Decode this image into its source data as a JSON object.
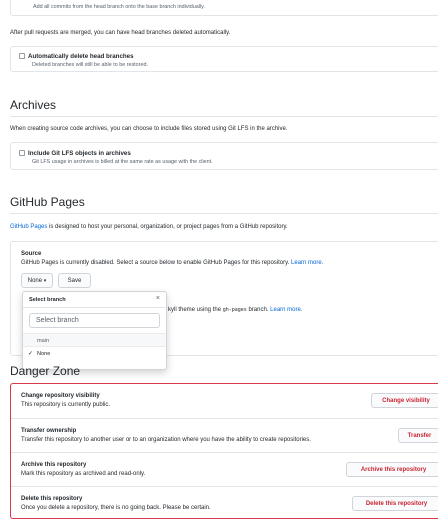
{
  "merge": {
    "rebase_desc": "Add all commits from the head branch onto the base branch individually.",
    "auto_delete_intro": "After pull requests are merged, you can have head branches deleted automatically.",
    "auto_delete_label": "Automatically delete head branches",
    "auto_delete_desc": "Deleted branches will still be able to be restored."
  },
  "archives": {
    "title": "Archives",
    "intro": "When creating source code archives, you can choose to include files stored using Git LFS in the archive.",
    "lfs_label": "Include Git LFS objects in archives",
    "lfs_desc": "Git LFS usage in archives is billed at the same rate as usage with the client."
  },
  "pages": {
    "title": "GitHub Pages",
    "intro_link": "GitHub Pages",
    "intro_rest": " is designed to host your personal, organization, or project pages from a GitHub repository.",
    "source_label": "Source",
    "source_desc": "GitHub Pages is currently disabled. Select a source below to enable GitHub Pages for this repository.",
    "learn_more": "Learn more.",
    "branch_button": "None",
    "save_button": "Save",
    "theme_text_a": "kyll theme using the ",
    "theme_code": "gh-pages",
    "theme_text_b": " branch.",
    "theme_learn_more": "Learn more."
  },
  "dropdown": {
    "title": "Select branch",
    "filter_placeholder": "Select branch",
    "items": [
      "main",
      "None"
    ]
  },
  "danger": {
    "title": "Danger Zone",
    "rows": [
      {
        "title": "Change repository visibility",
        "desc": "This repository is currently public.",
        "button": "Change visibility"
      },
      {
        "title": "Transfer ownership",
        "desc": "Transfer this repository to another user or to an organization where you have the ability to create repositories.",
        "button": "Transfer"
      },
      {
        "title": "Archive this repository",
        "desc": "Mark this repository as archived and read-only.",
        "button": "Archive this repository"
      },
      {
        "title": "Delete this repository",
        "desc": "Once you delete a repository, there is no going back. Please be certain.",
        "button": "Delete this repository"
      }
    ]
  },
  "colors": {
    "link": "#0366d6",
    "danger": "#d73a49",
    "danger_text": "#cb2431"
  },
  "icons": {
    "checkbox": "checkbox-icon",
    "caret": "caret-down-icon",
    "close": "close-icon",
    "check": "check-icon"
  }
}
